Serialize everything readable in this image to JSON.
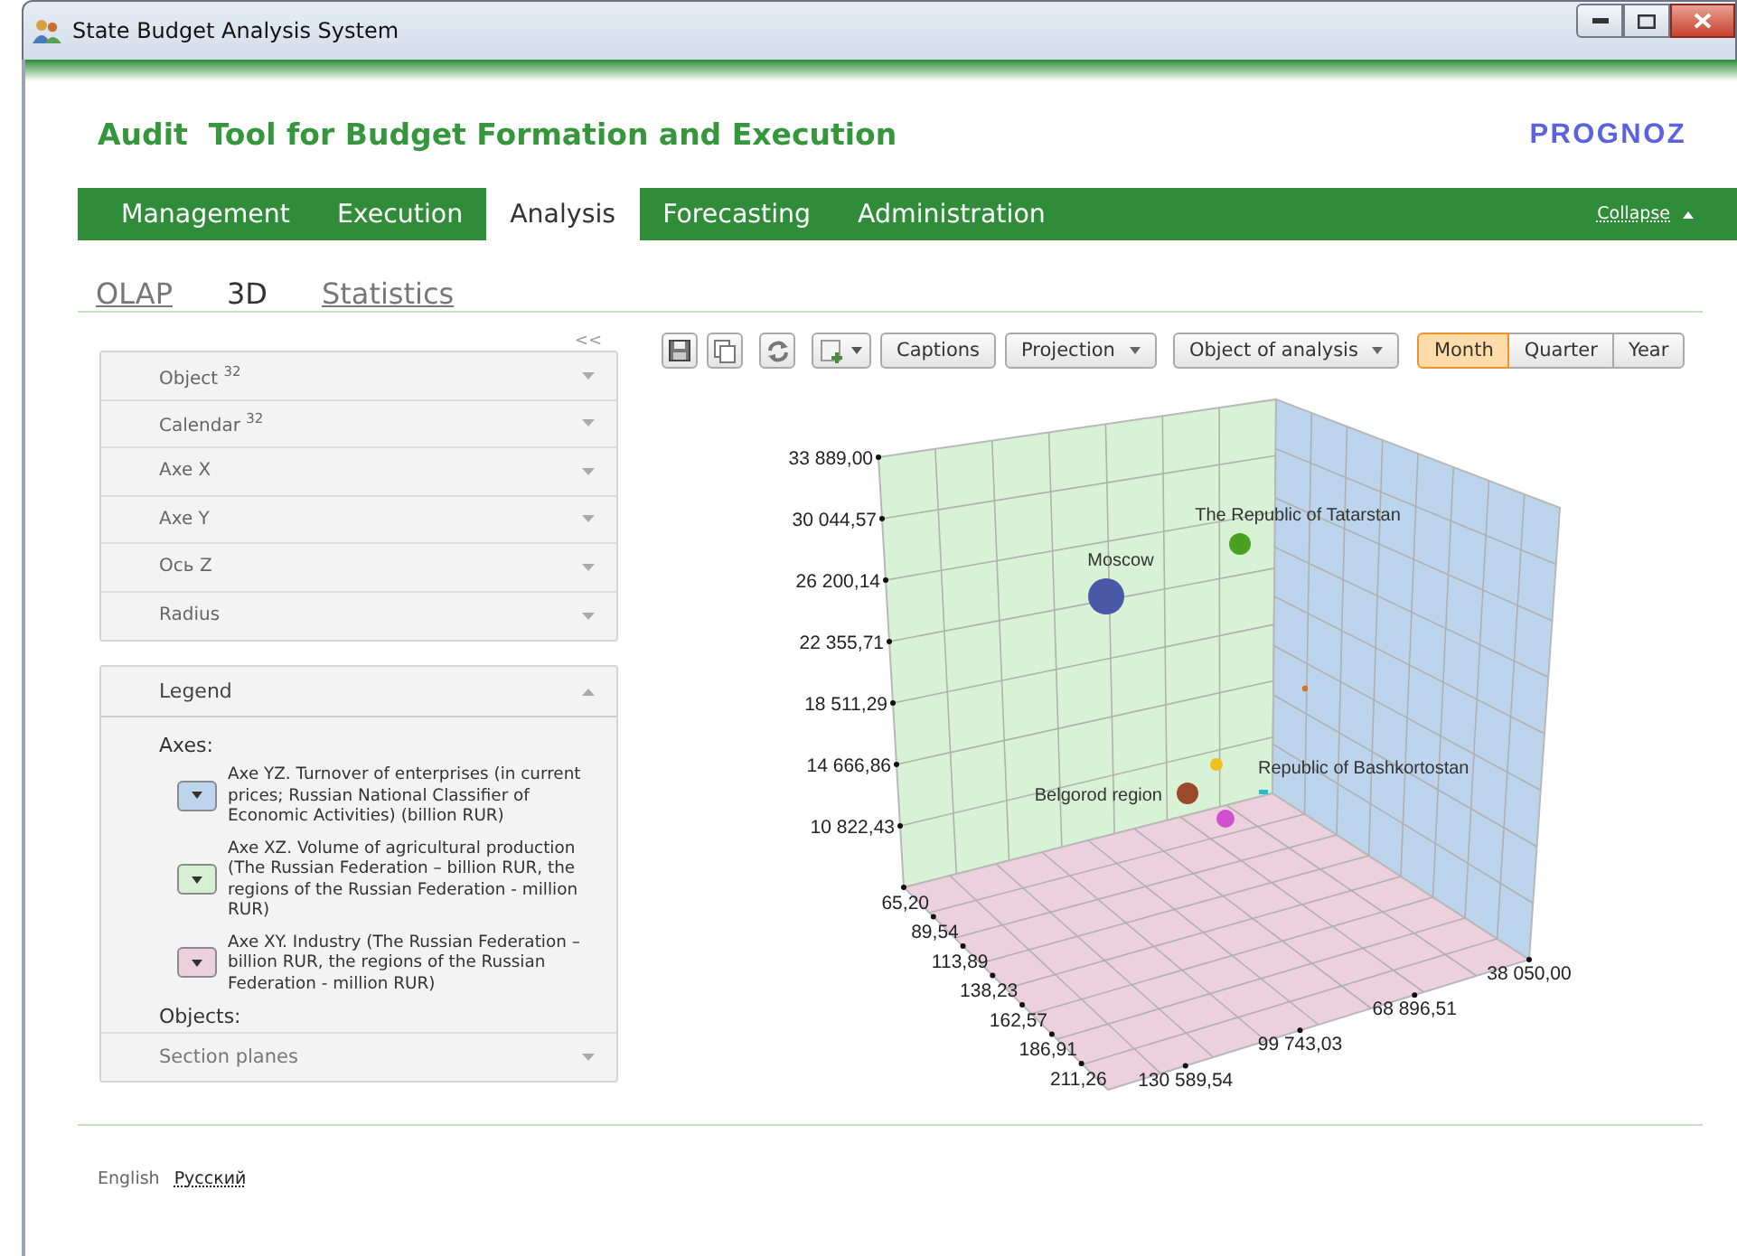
{
  "window": {
    "title": "State Budget Analysis System"
  },
  "header": {
    "title": "Audit  Tool for Budget Formation and Execution",
    "logo": "PROGNOZ"
  },
  "nav": {
    "tabs": [
      {
        "label": "Management",
        "selected": false
      },
      {
        "label": "Execution",
        "selected": false
      },
      {
        "label": "Analysis",
        "selected": true
      },
      {
        "label": "Forecasting",
        "selected": false
      },
      {
        "label": "Administration",
        "selected": false
      }
    ],
    "collapse": "Collapse"
  },
  "subtabs": [
    {
      "label": "OLAP",
      "selected": false
    },
    {
      "label": "3D",
      "selected": true
    },
    {
      "label": "Statistics",
      "selected": false
    }
  ],
  "panel": {
    "collapse": "<<",
    "sections": [
      {
        "label": "Object",
        "count": "32"
      },
      {
        "label": "Calendar",
        "count": "32"
      },
      {
        "label": "Axe X"
      },
      {
        "label": "Axe Y"
      },
      {
        "label": "Ось Z"
      },
      {
        "label": "Radius"
      }
    ],
    "legend": {
      "title": "Legend",
      "axes_label": "Axes:",
      "axes": [
        {
          "text": "Axe YZ. Turnover of enterprises (in current prices; Russian National Classifier of Economic Activities) (billion RUR)",
          "color": "#bcd5ec"
        },
        {
          "text": "Axe XZ. Volume of agricultural production (The Russian Federation – billion RUR, the regions of the Russian Federation - million RUR)",
          "color": "#d6f0d4"
        },
        {
          "text": "Axe XY. Industry (The Russian Federation – billion RUR, the regions of the Russian Federation - million RUR)",
          "color": "#ecd0dc"
        }
      ],
      "objects_label": "Objects:"
    },
    "section_planes": "Section planes"
  },
  "toolbar": {
    "captions": "Captions",
    "dropdowns": [
      "Projection",
      "Object of analysis"
    ],
    "periods": [
      {
        "label": "Month",
        "selected": true
      },
      {
        "label": "Quarter",
        "selected": false
      },
      {
        "label": "Year",
        "selected": false
      }
    ]
  },
  "chart": {
    "y_ticks": [
      "33 889,00",
      "30 044,57",
      "26 200,14",
      "22 355,71",
      "18 511,29",
      "14 666,86",
      "10 822,43"
    ],
    "x_ticks": [
      "65,20",
      "89,54",
      "113,89",
      "138,23",
      "162,57",
      "186,91",
      "211,26"
    ],
    "z_ticks": [
      "38 050,00",
      "68 896,51",
      "99 743,03",
      "130 589,54"
    ],
    "points": [
      {
        "label": "Moscow",
        "color": "#4a58a8"
      },
      {
        "label": "The Republic of Tatarstan",
        "color": "#4aa020"
      },
      {
        "color": "#e07020"
      },
      {
        "color": "#f0c020"
      },
      {
        "label": "Belgorod region",
        "color": "#9a4a2a"
      },
      {
        "label": "Republic of Bashkortostan",
        "color": "#20c0d0"
      },
      {
        "color": "#d050d0"
      }
    ]
  },
  "footer": {
    "languages": [
      {
        "label": "English",
        "selected": true
      },
      {
        "label": "Русский",
        "selected": false
      }
    ]
  }
}
